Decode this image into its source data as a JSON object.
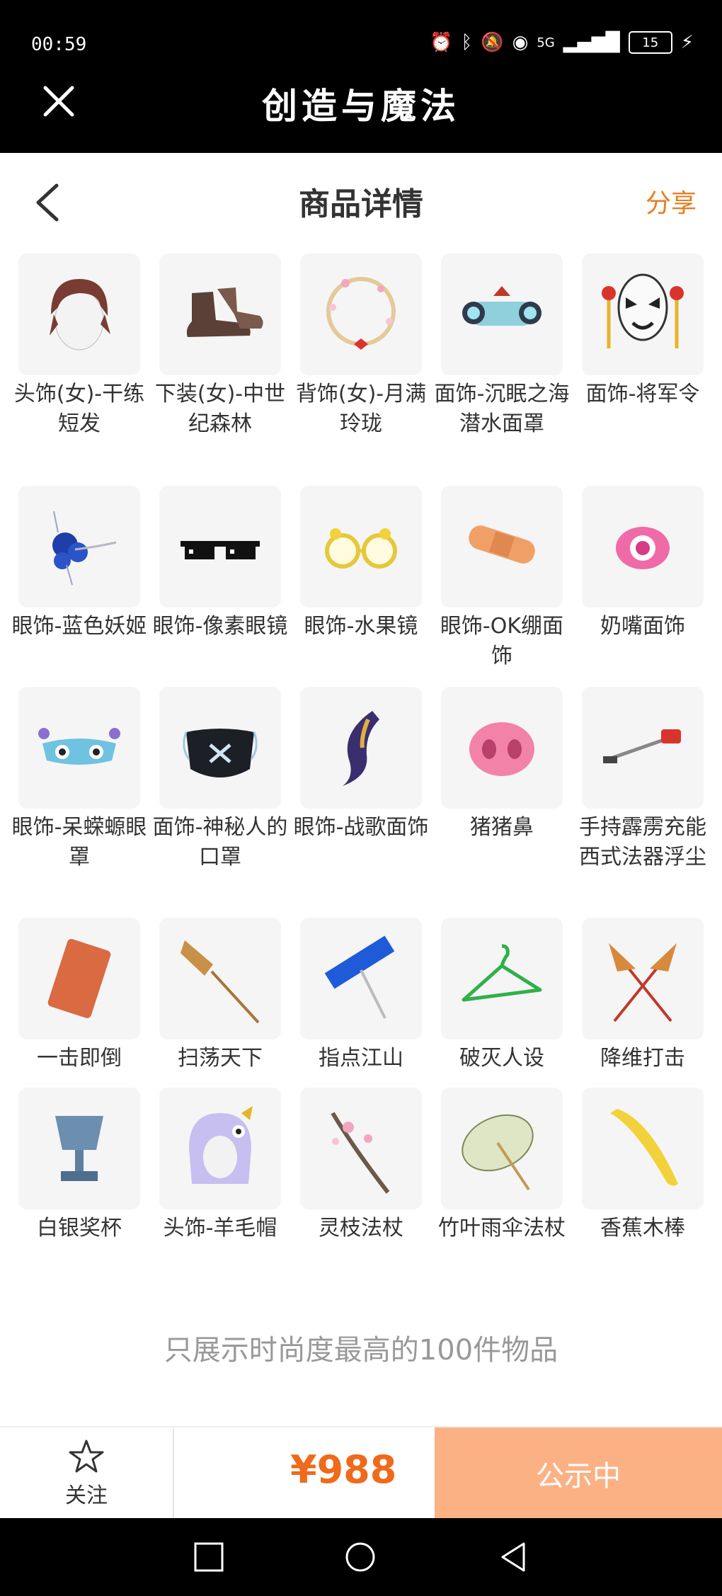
{
  "status": {
    "time": "00:59",
    "network": "5G",
    "battery": "15"
  },
  "app": {
    "title": "创造与魔法"
  },
  "header": {
    "title": "商品详情",
    "share": "分享"
  },
  "items": [
    {
      "name": "头饰(女)-干练短发",
      "icon": "short-hair-icon"
    },
    {
      "name": "下装(女)-中世纪森林",
      "icon": "boots-icon"
    },
    {
      "name": "背饰(女)-月满玲珑",
      "icon": "moon-ring-icon"
    },
    {
      "name": "面饰-沉眠之海潜水面罩",
      "icon": "diving-mask-icon"
    },
    {
      "name": "面饰-将军令",
      "icon": "opera-mask-icon"
    },
    {
      "name": "眼饰-蓝色妖姬",
      "icon": "blue-rose-icon"
    },
    {
      "name": "眼饰-像素眼镜",
      "icon": "pixel-glasses-icon"
    },
    {
      "name": "眼饰-水果镜",
      "icon": "fruit-glasses-icon"
    },
    {
      "name": "眼饰-OK绷面饰",
      "icon": "bandage-icon"
    },
    {
      "name": "奶嘴面饰",
      "icon": "pacifier-icon"
    },
    {
      "name": "眼饰-呆蝾螈眼罩",
      "icon": "axolotl-mask-icon"
    },
    {
      "name": "面饰-神秘人的口罩",
      "icon": "face-mask-icon"
    },
    {
      "name": "眼饰-战歌面饰",
      "icon": "war-mask-icon"
    },
    {
      "name": "猪猪鼻",
      "icon": "pig-nose-icon"
    },
    {
      "name": "手持霹雳充能西式法器浮尘",
      "icon": "vacuum-icon"
    },
    {
      "name": "一击即倒",
      "icon": "brick-icon"
    },
    {
      "name": "扫荡天下",
      "icon": "broom-icon"
    },
    {
      "name": "指点江山",
      "icon": "sign-icon"
    },
    {
      "name": "破灭人设",
      "icon": "hanger-icon"
    },
    {
      "name": "降维打击",
      "icon": "duster-icon"
    },
    {
      "name": "白银奖杯",
      "icon": "trophy-icon"
    },
    {
      "name": "头饰-羊毛帽",
      "icon": "sheep-hat-icon"
    },
    {
      "name": "灵枝法杖",
      "icon": "branch-staff-icon"
    },
    {
      "name": "竹叶雨伞法杖",
      "icon": "umbrella-icon"
    },
    {
      "name": "香蕉木棒",
      "icon": "banana-icon"
    }
  ],
  "note": "只展示时尚度最高的100件物品",
  "actions": {
    "follow": "关注",
    "price": "¥988",
    "status_button": "公示中"
  },
  "colors": {
    "accent": "#ef6a1b",
    "button": "#fcb184"
  }
}
